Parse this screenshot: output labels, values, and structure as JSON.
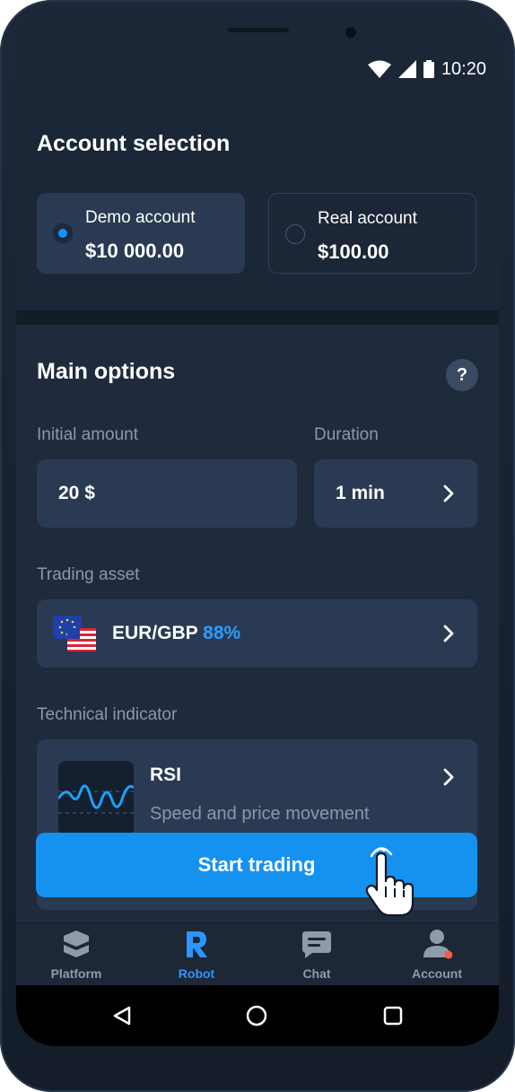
{
  "status": {
    "time": "10:20"
  },
  "account_selection": {
    "title": "Account selection",
    "demo": {
      "label": "Demo account",
      "amount": "$10 000.00",
      "selected": true
    },
    "real": {
      "label": "Real account",
      "amount": "$100.00",
      "selected": false
    }
  },
  "main_options": {
    "title": "Main options",
    "help_label": "?",
    "initial_amount": {
      "label": "Initial amount",
      "value": "20 $"
    },
    "duration": {
      "label": "Duration",
      "value": "1 min"
    },
    "trading_asset": {
      "label": "Trading asset",
      "pair": "EUR/GBP",
      "payout": "88%"
    },
    "technical_indicator": {
      "label": "Technical indicator",
      "name": "RSI",
      "description": "Speed and price movement indicator"
    }
  },
  "start_button": {
    "label": "Start trading"
  },
  "nav": {
    "items": [
      {
        "label": "Platform",
        "icon": "platform-icon",
        "active": false
      },
      {
        "label": "Robot",
        "icon": "robot-icon",
        "active": true
      },
      {
        "label": "Chat",
        "icon": "chat-icon",
        "active": false
      },
      {
        "label": "Account",
        "icon": "account-icon",
        "active": false,
        "badge": true
      }
    ]
  },
  "colors": {
    "accent": "#1592f0",
    "payout": "#2c9cff",
    "badge": "#ff5a3c",
    "background": "#1f2b3c"
  }
}
